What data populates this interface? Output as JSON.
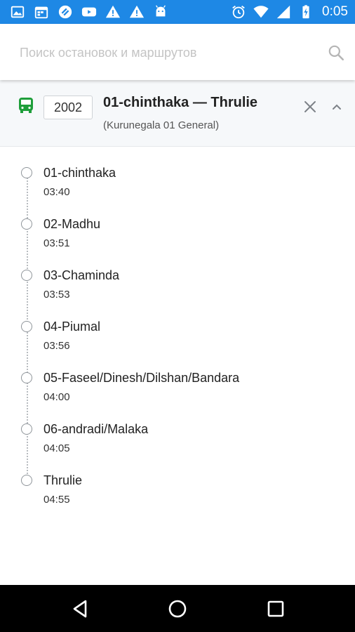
{
  "status_bar": {
    "time": "0:05",
    "left_icons": [
      "image-icon",
      "calendar-icon",
      "sync-icon",
      "youtube-icon",
      "warning-icon",
      "warning-icon",
      "android-icon"
    ],
    "right_icons": [
      "alarm-icon",
      "wifi-icon",
      "signal-icon",
      "battery-charging-icon"
    ],
    "color": "#1e88e5"
  },
  "search": {
    "placeholder": "Поиск остановок и маршрутов",
    "value": ""
  },
  "route": {
    "number": "2002",
    "name": "01-chinthaka — Thrulie",
    "subtitle": "(Kurunegala 01 General)",
    "icon_color": "#1e9e3a"
  },
  "stops": [
    {
      "name": "01-chinthaka",
      "time": "03:40"
    },
    {
      "name": "02-Madhu",
      "time": "03:51"
    },
    {
      "name": "03-Chaminda",
      "time": "03:53"
    },
    {
      "name": "04-Piumal",
      "time": "03:56"
    },
    {
      "name": "05-Faseel/Dinesh/Dilshan/Bandara",
      "time": "04:00"
    },
    {
      "name": "06-andradi/Malaka",
      "time": "04:05"
    },
    {
      "name": "Thrulie",
      "time": "04:55"
    }
  ],
  "nav": {
    "buttons": [
      "back-icon",
      "home-icon",
      "recents-icon"
    ]
  }
}
